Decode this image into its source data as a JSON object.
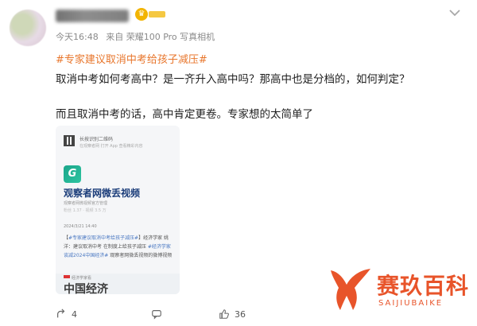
{
  "post": {
    "time": "今天16:48",
    "source": "来自 荣耀100 Pro 写真相机",
    "hashtag": "#专家建议取消中考给孩子减压#",
    "text_line1": "取消中考如何考高中？是一齐升入高中吗？那高中也是分档的，如何判定？",
    "text_line2": "而且取消中考的话，高中肯定更卷。专家想的太简单了"
  },
  "card": {
    "qr_label": "长按识别二维码",
    "qr_sub": "在观察者网 打开 App 查看精彩内容",
    "logo_letter": "G",
    "channel_name": "观察者网微丢视频",
    "channel_sub": "观察者网微视频官方管理",
    "stats": "粉丝 1.37 · 视频 3.5 万",
    "date": "2024/3/21  14:40",
    "summary_prefix": "【",
    "summary_tag": "#专家建议取消中考给孩子减压#",
    "summary_mid": "】经济学家 姚洋：建议取消中考 在制度上给孩子减压 ",
    "summary_tag2": "#经济学家谈减2024中国经济#",
    "summary_end": " 观察者网微丢视频的微博视频",
    "banner_small": "经济学家看",
    "banner_big": "中国经济"
  },
  "actions": {
    "share_count": "4",
    "comment_count": "",
    "like_count": "36"
  },
  "watermark": {
    "brand": "赛玖百科",
    "sub": "SAIJIUBAIKE"
  },
  "colors": {
    "hashtag": "#e8762c",
    "brand": "#e8542a",
    "vip": "#f2b400"
  },
  "icons": [
    "chevron-down-icon",
    "crown-icon",
    "qr-code-icon",
    "share-icon",
    "comment-icon",
    "like-icon"
  ]
}
